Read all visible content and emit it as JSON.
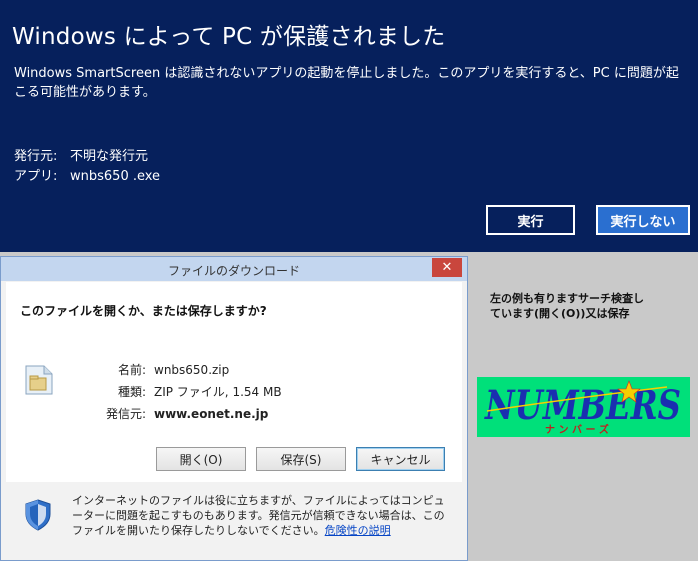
{
  "smartscreen": {
    "title": "Windows によって PC が保護されました",
    "message": "Windows SmartScreen は認識されないアプリの起動を停止しました。このアプリを実行すると、PC に問題が起こる可能性があります。",
    "publisher_label": "発行元:",
    "publisher_value": "不明な発行元",
    "app_label": "アプリ:",
    "app_value": "wnbs650 .exe",
    "run_button": "実行",
    "dont_run_button": "実行しない",
    "colors": {
      "background": "#06205c",
      "accent_button": "#2a6fd0"
    }
  },
  "download_dialog": {
    "title": "ファイルのダウンロード",
    "close_glyph": "✕",
    "question": "このファイルを開くか、または保存しますか?",
    "name_label": "名前:",
    "name_value": "wnbs650.zip",
    "type_label": "種類:",
    "type_value": "ZIP ファイル, 1.54 MB",
    "from_label": "発信元:",
    "from_value": "www.eonet.ne.jp",
    "open_button": "開く(O)",
    "save_button": "保存(S)",
    "cancel_button": "キャンセル",
    "warning_text": "インターネットのファイルは役に立ちますが、ファイルによってはコンピューターに問題を起こすものもあります。発信元が信頼できない場合は、このファイルを開いたり保存したりしないでください。",
    "danger_link": "危険性の説明",
    "icons": {
      "file": "zip-file-icon",
      "shield": "security-shield-icon"
    }
  },
  "side_note": {
    "line1": "左の例も有りますサーチ検査し",
    "line2": "ています(開く(O))又は保存"
  },
  "logo": {
    "main": "NUMBERS",
    "sub": "ナ ン バ ー ズ",
    "colors": {
      "background": "#00e07a",
      "text": "#1a2fb0",
      "star": "#f6d000"
    }
  }
}
